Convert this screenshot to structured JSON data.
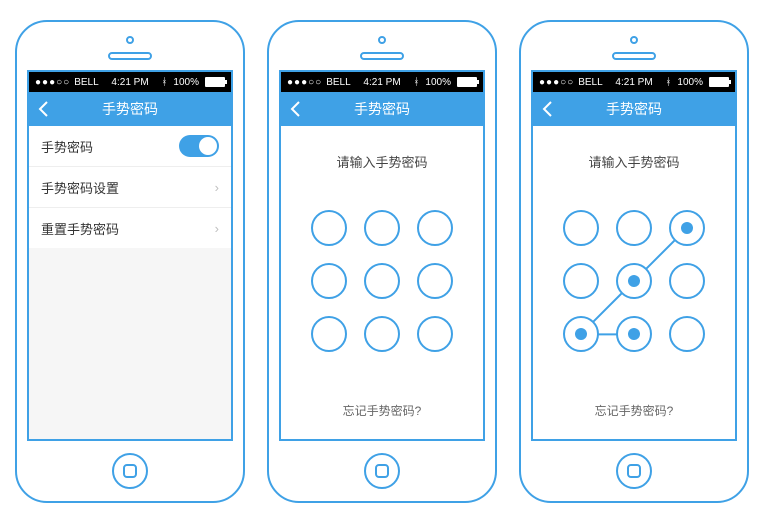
{
  "status": {
    "carrier": "BELL",
    "time": "4:21 PM",
    "battery": "100%"
  },
  "nav": {
    "title": "手势密码"
  },
  "settings": {
    "rows": [
      {
        "label": "手势密码"
      },
      {
        "label": "手势密码设置"
      },
      {
        "label": "重置手势密码"
      }
    ]
  },
  "pattern": {
    "prompt": "请输入手势密码",
    "forgot": "忘记手势密码?",
    "nodes": [
      1,
      2,
      3,
      4,
      5,
      6,
      7,
      8,
      9
    ],
    "selected": [
      3,
      5,
      7,
      8
    ],
    "path": [
      [
        2,
        0
      ],
      [
        1,
        1
      ],
      [
        0,
        2
      ],
      [
        1,
        2
      ]
    ]
  },
  "colors": {
    "accent": "#3fa1e6"
  }
}
